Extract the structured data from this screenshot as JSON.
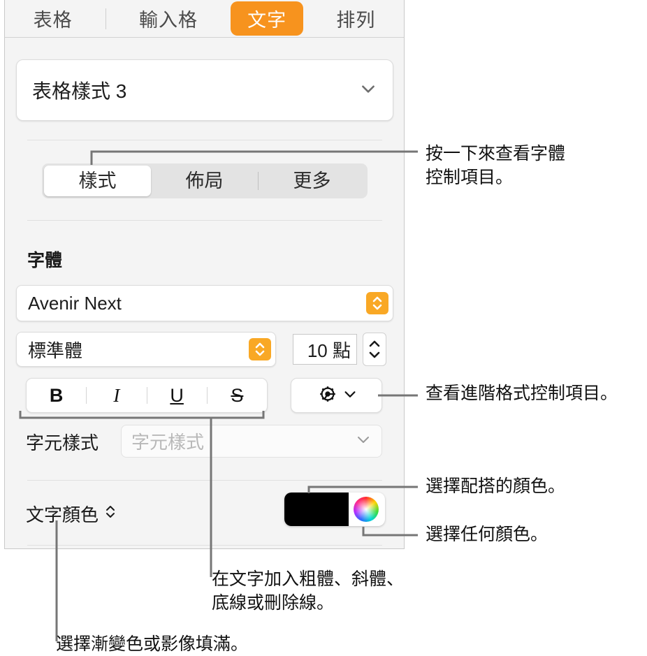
{
  "panel": {
    "tabs": [
      {
        "label": "表格",
        "selected": false
      },
      {
        "label": "輸入格",
        "selected": false
      },
      {
        "label": "文字",
        "selected": true
      },
      {
        "label": "排列",
        "selected": false
      }
    ],
    "table_style": {
      "value": "表格樣式 3",
      "icon": "chevron-down-icon"
    },
    "segmented": [
      {
        "label": "樣式",
        "selected": true
      },
      {
        "label": "佈局",
        "selected": false
      },
      {
        "label": "更多",
        "selected": false
      }
    ],
    "font_section": {
      "title": "字體",
      "family": "Avenir Next",
      "style": "標準體",
      "size": "10 點",
      "text_styles": [
        {
          "label": "B",
          "name": "bold"
        },
        {
          "label": "I",
          "name": "italic"
        },
        {
          "label": "U",
          "name": "underline"
        },
        {
          "label": "S",
          "name": "strikethrough"
        }
      ],
      "advanced_icon": "gear-icon",
      "advanced_chevron": "chevron-down-icon"
    },
    "character_style": {
      "label": "字元樣式",
      "placeholder": "字元樣式",
      "icon": "chevron-down-icon"
    },
    "text_color": {
      "label": "文字顏色",
      "disclosure_icon": "chevron-up-down-icon",
      "swatch_color": "#000000",
      "wheel_icon": "color-wheel-icon"
    },
    "colors": {
      "accent": "#f7931e",
      "stepper": "#f9a825",
      "panel_bg": "#f4f4f4",
      "swatch": "#000000"
    }
  },
  "callouts": {
    "font_controls": "按一下來查看字體\n控制項目。",
    "advanced_format": "查看進階格式控制項目。",
    "matching_color": "選擇配搭的顏色。",
    "any_color": "選擇任何顏色。",
    "text_styles": "在文字加入粗體、斜體、\n底線或刪除線。",
    "gradient_fill": "選擇漸變色或影像填滿。"
  }
}
